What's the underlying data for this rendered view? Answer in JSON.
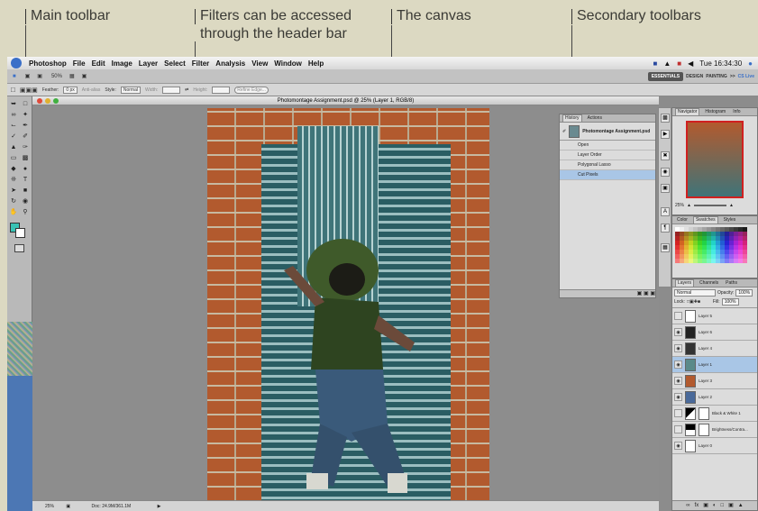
{
  "annotations": {
    "main_toolbar": "Main toolbar",
    "filters_line1": "Filters can be accessed",
    "filters_line2": "through the header bar",
    "canvas": "The canvas",
    "secondary": "Secondary toolbars"
  },
  "menubar": {
    "items": [
      "Photoshop",
      "File",
      "Edit",
      "Image",
      "Layer",
      "Select",
      "Filter",
      "Analysis",
      "View",
      "Window",
      "Help"
    ],
    "clock": "Tue 16:34:30"
  },
  "appbar": {
    "zoom": "50%",
    "workspaces": [
      "ESSENTIALS",
      "DESIGN",
      "PAINTING"
    ],
    "more": ">>",
    "cslive": "CS Live"
  },
  "options": {
    "feather_label": "Feather:",
    "feather_value": "0 px",
    "antialias": "Anti-alias",
    "style_label": "Style:",
    "style_value": "Normal",
    "width_label": "Width:",
    "height_label": "Height:",
    "refine": "Refine Edge..."
  },
  "document": {
    "title": "Photomontage Assignment.psd @ 25% (Layer 1, RGB/8)",
    "zoom": "25%",
    "doc_size": "Doc: 24.9M/361.1M"
  },
  "history": {
    "tabs": [
      "History",
      "Actions"
    ],
    "snapshot": "Photomontage Assignment.psd",
    "steps": [
      "Open",
      "Layer Order",
      "Polygonal Lasso",
      "Cut Pixels"
    ],
    "selected": "Cut Pixels"
  },
  "navigator": {
    "tabs": [
      "Navigator",
      "Histogram",
      "Info"
    ],
    "zoom": "25%"
  },
  "color_panel": {
    "tabs": [
      "Color",
      "Swatches",
      "Styles"
    ]
  },
  "layers": {
    "tabs": [
      "Layers",
      "Channels",
      "Paths"
    ],
    "blend": "Normal",
    "opacity_label": "Opacity:",
    "opacity": "100%",
    "lock_label": "Lock:",
    "fill_label": "Fill:",
    "fill": "100%",
    "items": [
      "Layer 5",
      "Layer 6",
      "Layer 4",
      "Layer 1",
      "Layer 3",
      "Layer 2",
      "Black & White 1",
      "Brightness/Contra...",
      "Layer 0"
    ],
    "selected": "Layer 1"
  },
  "colors": {
    "accent": "#3a6fc8",
    "selection": "#a9c6e6",
    "brick": "#b25a2e"
  }
}
